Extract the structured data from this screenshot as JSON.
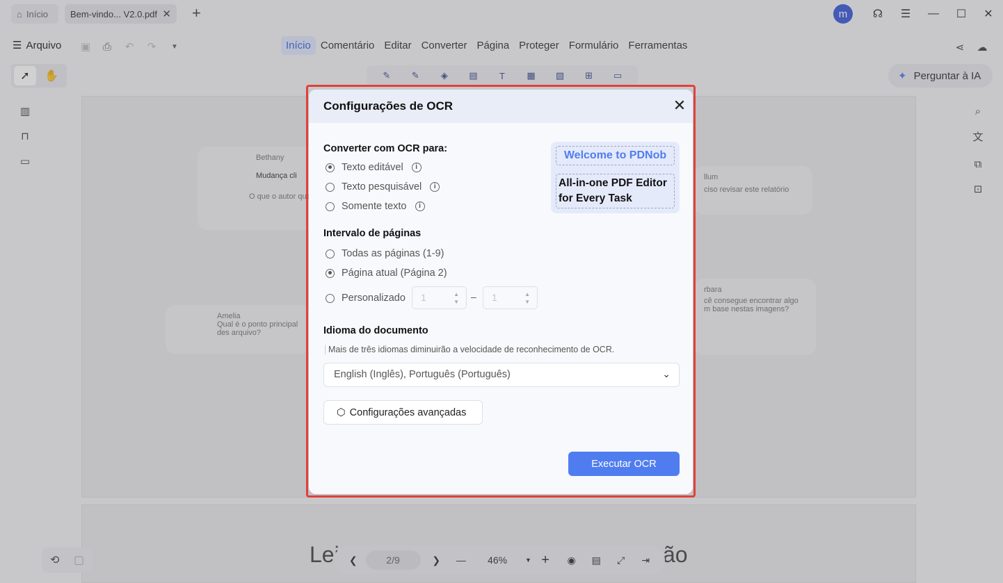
{
  "titlebar": {
    "home_tab": "Início",
    "doc_tab": "Bem-vindo... V2.0.pdf",
    "avatar_letter": "m"
  },
  "menubar": {
    "file_label": "Arquivo",
    "menus": [
      "Início",
      "Comentário",
      "Editar",
      "Converter",
      "Página",
      "Proteger",
      "Formulário",
      "Ferramentas"
    ],
    "active_menu": "Início"
  },
  "toolbar": {
    "ask_ai": "Perguntar à IA"
  },
  "background": {
    "card1_name": "Bethany",
    "card1_text": "Mudança cli",
    "card1_sub": "O que o autor que",
    "card2_name": "llum",
    "card2_text": "ciso revisar este relatório",
    "card3_name": "Amelia",
    "card3_text": "Qual é o ponto principal des arquivo?",
    "card4_name": "rbara",
    "card4_text": "cê consegue encontrar algo m base nestas imagens?",
    "big_left": "Lei",
    "big_right": "ão"
  },
  "bottom_nav": {
    "page": "2/9",
    "zoom": "46%"
  },
  "dialog": {
    "title": "Configurações de OCR",
    "convert_heading": "Converter com OCR para:",
    "convert_options": [
      "Texto editável",
      "Texto pesquisável",
      "Somente texto"
    ],
    "convert_selected": 0,
    "promo_line1": "Welcome to PDNob",
    "promo_line2": "All-in-one PDF Editor for Every Task",
    "range_heading": "Intervalo de páginas",
    "range_options": [
      "Todas as páginas (1-9)",
      "Página atual (Página 2)",
      "Personalizado"
    ],
    "range_selected": 1,
    "custom_from": "1",
    "custom_to": "1",
    "range_separator": "–",
    "language_heading": "Idioma do documento",
    "language_hint": "Mais de três idiomas diminuirão a velocidade de reconhecimento de OCR.",
    "language_value": "English (Inglês), Português (Português)",
    "advanced_label": "Configurações avançadas",
    "run_label": "Executar OCR"
  },
  "colors": {
    "accent": "#4f7df0",
    "highlight_frame": "#e0413a"
  }
}
